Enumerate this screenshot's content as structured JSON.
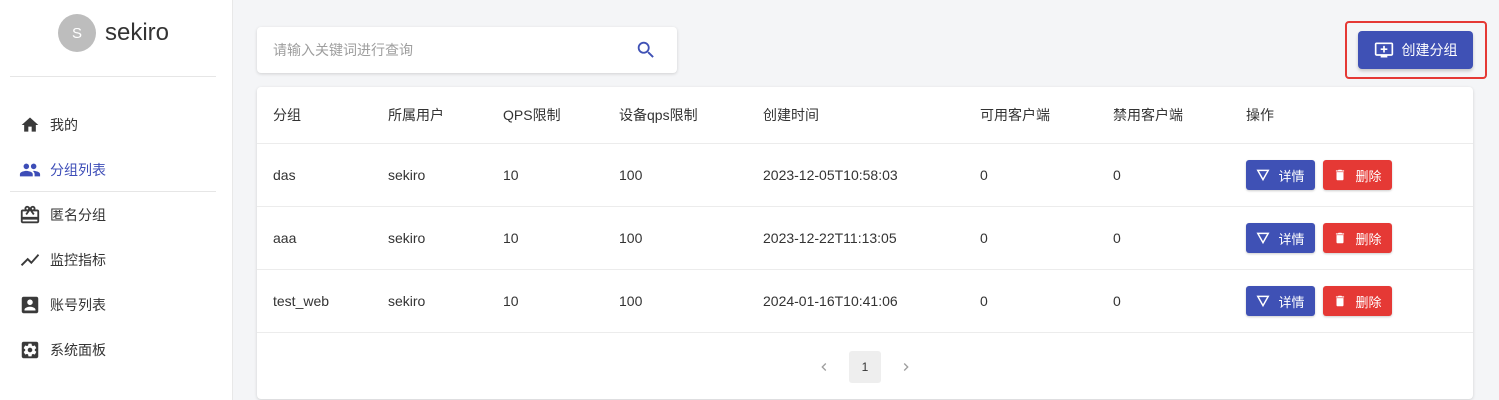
{
  "brand": {
    "avatar_letter": "S",
    "name": "sekiro"
  },
  "sidebar": {
    "items": [
      {
        "label": "我的",
        "icon": "home-icon",
        "active": false
      },
      {
        "label": "分组列表",
        "icon": "people-icon",
        "active": true
      },
      {
        "label": "匿名分组",
        "icon": "cake-icon",
        "active": false
      },
      {
        "label": "监控指标",
        "icon": "trend-icon",
        "active": false
      },
      {
        "label": "账号列表",
        "icon": "account-box-icon",
        "active": false
      },
      {
        "label": "系统面板",
        "icon": "settings-box-icon",
        "active": false
      }
    ]
  },
  "search": {
    "placeholder": "请输入关键词进行查询",
    "value": "",
    "icon": "search-icon"
  },
  "toolbar": {
    "create_label": "创建分组",
    "create_icon": "add-to-queue-icon"
  },
  "table": {
    "columns": [
      "分组",
      "所属用户",
      "QPS限制",
      "设备qps限制",
      "创建时间",
      "可用客户端",
      "禁用客户端",
      "操作"
    ],
    "rows": [
      {
        "group": "das",
        "user": "sekiro",
        "qps": "10",
        "device_qps": "100",
        "created": "2023-12-05T10:58:03",
        "enabled": "0",
        "disabled": "0"
      },
      {
        "group": "aaa",
        "user": "sekiro",
        "qps": "10",
        "device_qps": "100",
        "created": "2023-12-22T11:13:05",
        "enabled": "0",
        "disabled": "0"
      },
      {
        "group": "test_web",
        "user": "sekiro",
        "qps": "10",
        "device_qps": "100",
        "created": "2024-01-16T10:41:06",
        "enabled": "0",
        "disabled": "0"
      }
    ],
    "actions": {
      "detail_label": "详情",
      "delete_label": "删除"
    }
  },
  "pagination": {
    "current": "1"
  },
  "colors": {
    "primary": "#3f51b5",
    "danger": "#e53935",
    "highlight_border": "#e53935"
  }
}
